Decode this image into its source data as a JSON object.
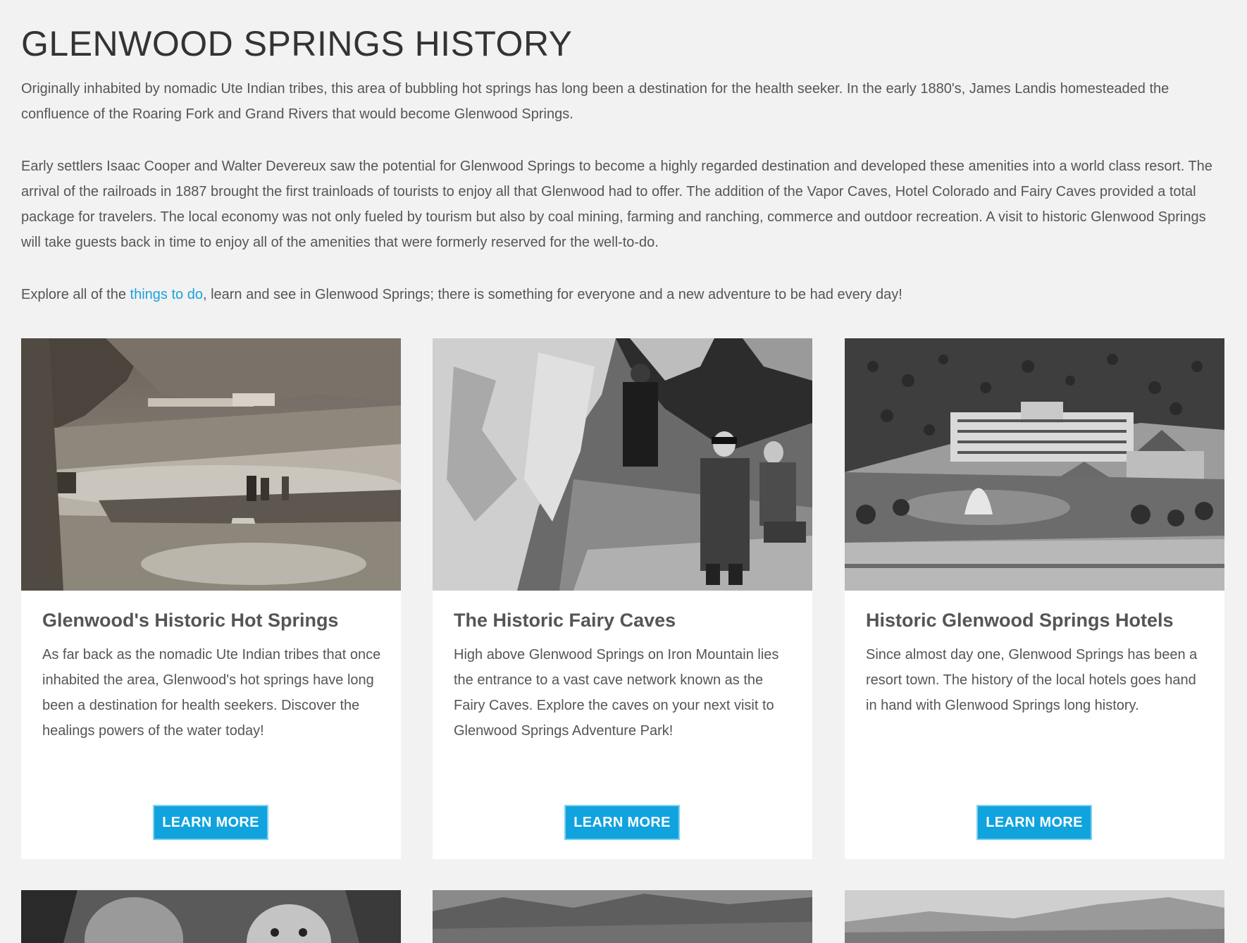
{
  "page": {
    "title": "GLENWOOD SPRINGS HISTORY"
  },
  "intro": {
    "p1": "Originally inhabited by nomadic Ute Indian tribes, this area of bubbling hot springs has long been a destination for the health seeker. In the early 1880's, James Landis homesteaded the confluence of the Roaring Fork and Grand Rivers that would become Glenwood Springs.",
    "p2": "Early settlers Isaac Cooper and Walter Devereux saw the potential for Glenwood Springs to become a highly regarded destination and developed these amenities into a world class resort. The arrival of the railroads in 1887 brought the first trainloads of tourists to enjoy all that Glenwood had to offer. The addition of the Vapor Caves, Hotel Colorado and Fairy Caves provided a total package for travelers. The local economy was not only fueled by tourism but also by coal mining, farming and ranching, commerce and outdoor recreation. A visit to historic Glenwood Springs will take guests back in time to enjoy all of the amenities that were formerly reserved for the well-to-do.",
    "p3_before": "Explore all of the ",
    "p3_link": "things to do",
    "p3_after": ", learn and see in Glenwood Springs; there is something for everyone and a new adventure to be had every day!"
  },
  "colors": {
    "background": "#f2f2f2",
    "link": "#1da1d9",
    "button": "#10a3dd",
    "button_border": "#7fd0f0",
    "text": "#555555",
    "title": "#333333"
  },
  "cards": [
    {
      "title": "Glenwood's Historic Hot Springs",
      "text": "As far back as the nomadic Ute Indian tribes that once inhabited the area, Glenwood's hot springs have long been a destination for health seekers. Discover the healings powers of the water today!",
      "button": "LEARN MORE",
      "image": "historic-hot-springs-photo"
    },
    {
      "title": "The Historic Fairy Caves",
      "text": "High above Glenwood Springs on Iron Mountain lies the entrance to a vast cave network known as the Fairy Caves. Explore the caves on your next visit to Glenwood Springs Adventure Park!",
      "button": "LEARN MORE",
      "image": "fairy-caves-photo"
    },
    {
      "title": "Historic Glenwood Springs Hotels",
      "text": "Since almost day one, Glenwood Springs has been a resort town. The history of the local hotels goes hand in hand with Glenwood Springs long history.",
      "button": "LEARN MORE",
      "image": "historic-hotels-photo"
    }
  ]
}
